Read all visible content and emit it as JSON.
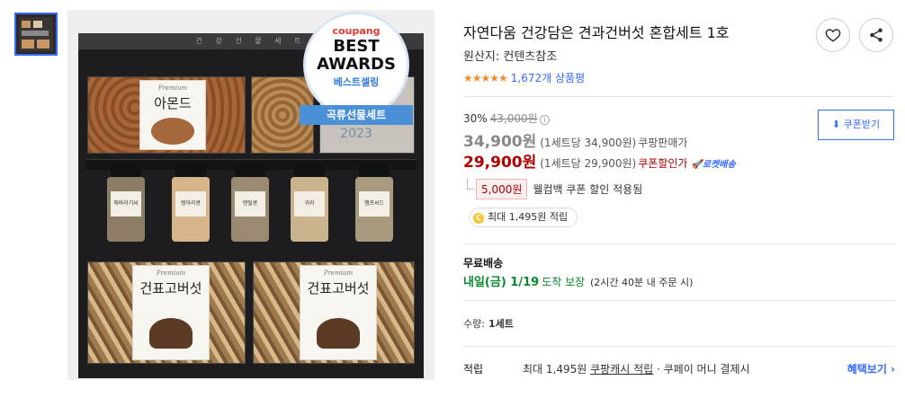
{
  "product": {
    "title": "자연다움 건강담은 견과건버섯 혼합세트 1호",
    "origin": "원산지: 컨텐츠참조",
    "stars": "★★★★★",
    "review_count": "1,672개 상품평"
  },
  "image": {
    "box_strip": "건 강 선 물 세 트",
    "almond_premium": "Premium",
    "almond_name": "아몬드",
    "mushroom_premium": "Premium",
    "mushroom_name": "건표고버섯",
    "mushroom_premium2": "Premium",
    "mushroom_name2": "건표고버섯",
    "jars": [
      "해바라기씨",
      "병아리콩",
      "렌틸콩",
      "귀리",
      "햄프씨드"
    ]
  },
  "badge": {
    "brand": "coupang",
    "best": "BEST",
    "awards": "AWARDS",
    "seller": "베스트셀링",
    "category": "곡류선물세트",
    "year": "2023"
  },
  "pricing": {
    "discount_rate": "30%",
    "original_price": "43,000원",
    "price": "34,900원",
    "price_unit": "(1세트당 34,900원)",
    "price_label": "쿠팡판매가",
    "coupon_price": "29,900원",
    "coupon_unit": "(1세트당 29,900원)",
    "coupon_label": "쿠폰할인가",
    "rocket": "로켓배송",
    "cashback_amount": "5,000원",
    "cashback_text": "웰컴백 쿠폰 할인 적용됨",
    "coupon_button": "쿠폰받기",
    "reward_text": "최대 1,495원 적립",
    "coin": "C"
  },
  "shipping": {
    "title": "무료배송",
    "date": "내일(금) 1/19",
    "guarantee": "도착 보장",
    "note": "(2시간 40분 내 주문 시)"
  },
  "quantity": {
    "label": "수량:",
    "value": "1세트"
  },
  "reward": {
    "key": "적립",
    "prefix": "최대 1,495원 ",
    "link": "쿠팡캐시 적립",
    "suffix": " · 쿠페이 머니 결제시",
    "more": "혜택보기 ›"
  },
  "colors": {
    "accent": "#346aff",
    "sale": "#ae0000",
    "guarantee": "#0a8a2c",
    "stars": "#f08b2f"
  }
}
